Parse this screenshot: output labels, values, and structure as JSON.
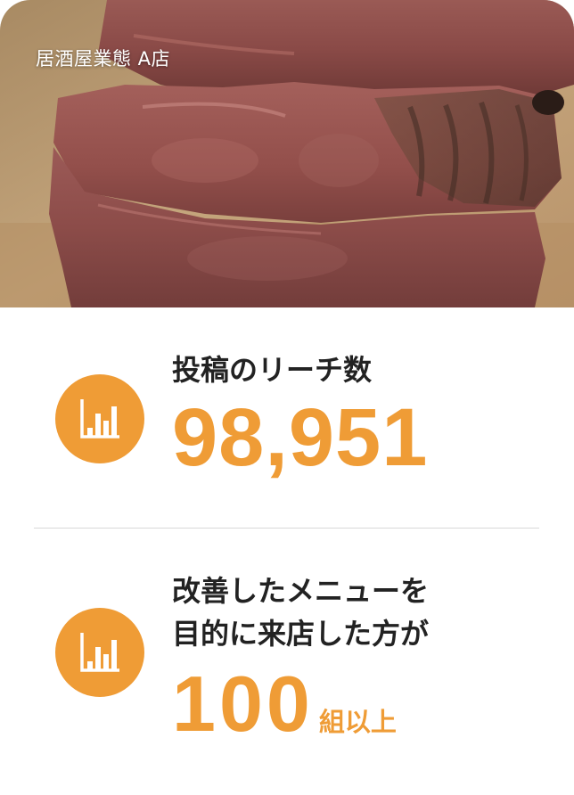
{
  "hero": {
    "store_label": "居酒屋業態 A店"
  },
  "stats": [
    {
      "icon": "bar-chart-icon",
      "label_lines": [
        "投稿のリーチ数"
      ],
      "value": "98,951",
      "unit": ""
    },
    {
      "icon": "bar-chart-icon",
      "label_lines": [
        "改善したメニューを",
        "目的に来店した方が"
      ],
      "value": "100",
      "unit": "組以上"
    }
  ],
  "colors": {
    "accent": "#ef9c36",
    "text": "#222222",
    "divider": "#d9d9d9",
    "background": "#ffffff"
  }
}
